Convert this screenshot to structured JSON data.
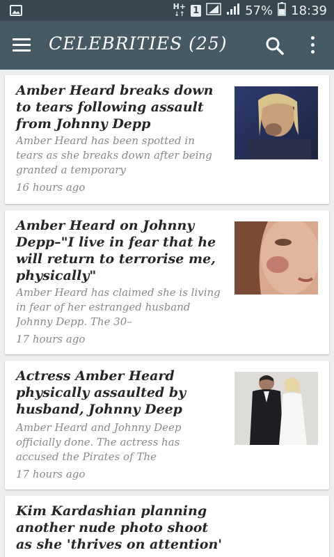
{
  "status_bar": {
    "network": "H+",
    "sim": "1",
    "battery": "57%",
    "time": "18:39"
  },
  "app_bar": {
    "title": "CELEBRITIES (25)",
    "color": "#455a64",
    "status_color": "#37474f"
  },
  "icons": {
    "menu": "hamburger-menu-icon",
    "search": "search-icon",
    "more": "more-vertical-icon"
  },
  "articles": [
    {
      "title": "Amber Heard breaks down to tears following assault from Johnny Depp",
      "summary": "Amber Heard has been spotted in tears as she breaks down after being granted a temporary",
      "time": "16 hours ago"
    },
    {
      "title": "Amber Heard on Johnny Depp–\"I live in fear that he will return  to terrorise me, physically\"",
      "summary": "Amber Heard has claimed she is living in fear of her estranged husband Johnny Depp. The 30–",
      "time": "17 hours ago"
    },
    {
      "title": "Actress Amber Heard physically assaulted by husband, Johnny Deep",
      "summary": "Amber Heard and Johnny Deep officially done. The actress has accused the Pirates of The",
      "time": "17 hours ago"
    },
    {
      "title": "Kim Kardashian planning another nude photo shoot as she 'thrives on attention'"
    }
  ]
}
